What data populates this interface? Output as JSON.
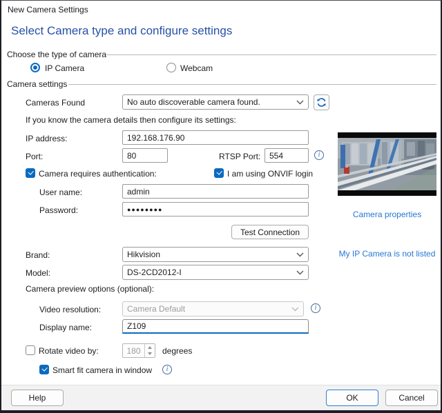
{
  "window": {
    "title": "New Camera Settings"
  },
  "heading": "Select Camera type and configure settings",
  "sections": {
    "camera_type_label": "Choose the type of camera",
    "camera_settings_label": "Camera settings"
  },
  "camera_type": {
    "ip_camera": "IP Camera",
    "webcam": "Webcam",
    "selected": "IP Camera"
  },
  "cameras_found": {
    "label": "Cameras Found",
    "selected": "No auto discoverable camera found."
  },
  "hint": "If you know the camera details then configure its settings:",
  "fields": {
    "ip_address": {
      "label": "IP address:",
      "value": "192.168.176.90"
    },
    "port": {
      "label": "Port:",
      "value": "80"
    },
    "rtsp_port": {
      "label": "RTSP Port:",
      "value": "554"
    },
    "username": {
      "label": "User name:",
      "value": "admin"
    },
    "password": {
      "label": "Password:",
      "value": "●●●●●●●●"
    },
    "brand": {
      "label": "Brand:",
      "selected": "Hikvision"
    },
    "model": {
      "label": "Model:",
      "selected": "DS-2CD2012-I"
    },
    "video_resolution": {
      "label": "Video resolution:",
      "selected": "Camera Default"
    },
    "display_name": {
      "label": "Display name:",
      "value": "Z109"
    },
    "rotate_video": {
      "label": "Rotate video by:",
      "value": "180",
      "suffix": "degrees",
      "checked": false
    }
  },
  "checkboxes": {
    "requires_auth": {
      "label": "Camera requires authentication:",
      "checked": true
    },
    "onvif": {
      "label": "I am using ONVIF login",
      "checked": true
    },
    "smart_fit": {
      "label": "Smart fit camera in window",
      "checked": true
    }
  },
  "preview_options_label": "Camera preview options (optional):",
  "buttons": {
    "test_connection": "Test Connection",
    "help": "Help",
    "ok": "OK",
    "cancel": "Cancel"
  },
  "links": {
    "camera_properties": "Camera properties",
    "not_listed": "My IP Camera is not listed"
  },
  "colors": {
    "accent": "#0b6ac0",
    "heading_blue": "#2750a8",
    "link_blue": "#2577d4"
  }
}
